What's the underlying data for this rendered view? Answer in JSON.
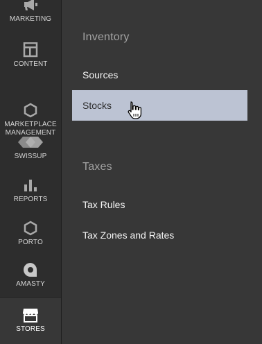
{
  "sidebar": {
    "items": [
      {
        "label": "MARKETING",
        "icon": "megaphone-icon"
      },
      {
        "label": "CONTENT",
        "icon": "layout-icon"
      },
      {
        "label": "MARKETPLACE\nMANAGEMENT",
        "icon": "hexagon-icon"
      },
      {
        "label": "SWISSUP",
        "icon": "swissup-logo-icon"
      },
      {
        "label": "REPORTS",
        "icon": "bar-chart-icon"
      },
      {
        "label": "PORTO",
        "icon": "hexagon-icon"
      },
      {
        "label": "AMASTY",
        "icon": "amasty-logo-icon"
      },
      {
        "label": "STORES",
        "icon": "storefront-icon",
        "active": true
      }
    ]
  },
  "submenu": {
    "inventory": {
      "title": "Inventory",
      "links": [
        "Sources",
        "Stocks"
      ]
    },
    "taxes": {
      "title": "Taxes",
      "links": [
        "Tax Rules",
        "Tax Zones and Rates"
      ]
    }
  },
  "colors": {
    "sidebar_bg": "#2d2d2d",
    "panel_bg": "#373737",
    "hover_bg": "#bcc3d3",
    "section_title": "#a3a3a3",
    "link_text": "#f5f5f5"
  }
}
